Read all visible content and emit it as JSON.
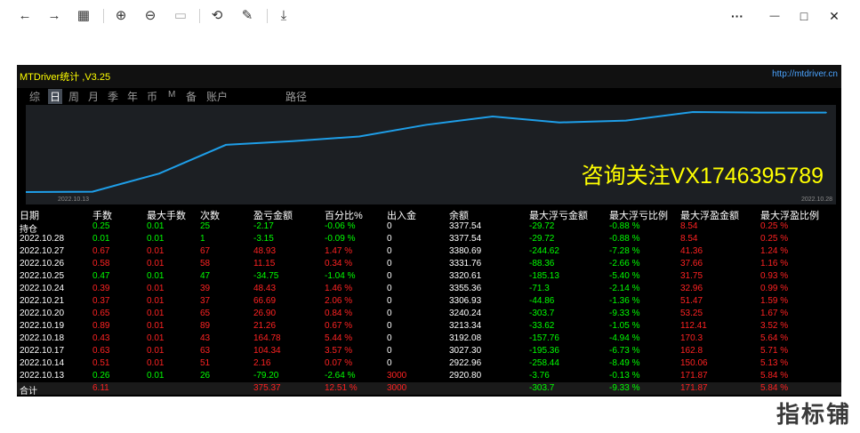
{
  "toolbar": {
    "back_icon": "←",
    "forward_icon": "→",
    "grid_icon": "▦",
    "zoom_in_icon": "⊕",
    "zoom_out_icon": "⊖",
    "fit_icon": "▭",
    "rotate_icon": "⟲",
    "edit_icon": "✎",
    "save_icon": "⤓",
    "more_icon": "···",
    "minimize_icon": "—",
    "maximize_icon": "□",
    "close_icon": "✕"
  },
  "app": {
    "title": "MTDriver统计 ,V3.25",
    "url": "http://mtdriver.cn",
    "tabs": [
      "综",
      "日",
      "周",
      "月",
      "季",
      "年",
      "币",
      "M",
      "备",
      "账户",
      "路径"
    ],
    "active_tab": "日",
    "watermark": "咨询关注VX1746395789",
    "date_left": "2022.10.13",
    "date_right": "2022.10.28",
    "logo_text": "指标铺"
  },
  "chart_data": {
    "type": "line",
    "values": [
      2920.8,
      2922.96,
      3027.3,
      3192.08,
      3213.34,
      3240.24,
      3306.93,
      3355.36,
      3320.61,
      3331.76,
      3380.69,
      3377.54,
      3377.54
    ],
    "x_labels": [
      "2022.10.13",
      "2022.10.28"
    ],
    "color": "#1e9ee8",
    "background": "#1c1f23"
  },
  "table": {
    "headers": [
      "日期",
      "手数",
      "最大手数",
      "次数",
      "盈亏金额",
      "百分比%",
      "出入金",
      "余额",
      "最大浮亏金额",
      "最大浮亏比例",
      "最大浮盈金额",
      "最大浮盈比例"
    ],
    "rows": [
      [
        "持仓",
        "0.25",
        "0.01",
        "25",
        "-2.17",
        "-0.06 %",
        "0",
        "3377.54",
        "-29.72",
        "-0.88 %",
        "8.54",
        "0.25 %"
      ],
      [
        "2022.10.28",
        "0.01",
        "0.01",
        "1",
        "-3.15",
        "-0.09 %",
        "0",
        "3377.54",
        "-29.72",
        "-0.88 %",
        "8.54",
        "0.25 %"
      ],
      [
        "2022.10.27",
        "0.67",
        "0.01",
        "67",
        "48.93",
        "1.47 %",
        "0",
        "3380.69",
        "-244.62",
        "-7.28 %",
        "41.36",
        "1.24 %"
      ],
      [
        "2022.10.26",
        "0.58",
        "0.01",
        "58",
        "11.15",
        "0.34 %",
        "0",
        "3331.76",
        "-88.36",
        "-2.66 %",
        "37.66",
        "1.16 %"
      ],
      [
        "2022.10.25",
        "0.47",
        "0.01",
        "47",
        "-34.75",
        "-1.04 %",
        "0",
        "3320.61",
        "-185.13",
        "-5.40 %",
        "31.75",
        "0.93 %"
      ],
      [
        "2022.10.24",
        "0.39",
        "0.01",
        "39",
        "48.43",
        "1.46 %",
        "0",
        "3355.36",
        "-71.3",
        "-2.14 %",
        "32.96",
        "0.99 %"
      ],
      [
        "2022.10.21",
        "0.37",
        "0.01",
        "37",
        "66.69",
        "2.06 %",
        "0",
        "3306.93",
        "-44.86",
        "-1.36 %",
        "51.47",
        "1.59 %"
      ],
      [
        "2022.10.20",
        "0.65",
        "0.01",
        "65",
        "26.90",
        "0.84 %",
        "0",
        "3240.24",
        "-303.7",
        "-9.33 %",
        "53.25",
        "1.67 %"
      ],
      [
        "2022.10.19",
        "0.89",
        "0.01",
        "89",
        "21.26",
        "0.67 %",
        "0",
        "3213.34",
        "-33.62",
        "-1.05 %",
        "112.41",
        "3.52 %"
      ],
      [
        "2022.10.18",
        "0.43",
        "0.01",
        "43",
        "164.78",
        "5.44 %",
        "0",
        "3192.08",
        "-157.76",
        "-4.94 %",
        "170.3",
        "5.64 %"
      ],
      [
        "2022.10.17",
        "0.63",
        "0.01",
        "63",
        "104.34",
        "3.57 %",
        "0",
        "3027.30",
        "-195.36",
        "-6.73 %",
        "162.8",
        "5.71 %"
      ],
      [
        "2022.10.14",
        "0.51",
        "0.01",
        "51",
        "2.16",
        "0.07 %",
        "0",
        "2922.96",
        "-258.44",
        "-8.49 %",
        "150.06",
        "5.13 %"
      ],
      [
        "2022.10.13",
        "0.26",
        "0.01",
        "26",
        "-79.20",
        "-2.64 %",
        "3000",
        "2920.80",
        "-3.76",
        "-0.13 %",
        "171.87",
        "5.84 %"
      ]
    ],
    "total": [
      "合计",
      "6.11",
      "",
      "",
      "375.37",
      "12.51 %",
      "3000",
      "",
      "-303.7",
      "-9.33 %",
      "171.87",
      "5.84 %"
    ]
  }
}
